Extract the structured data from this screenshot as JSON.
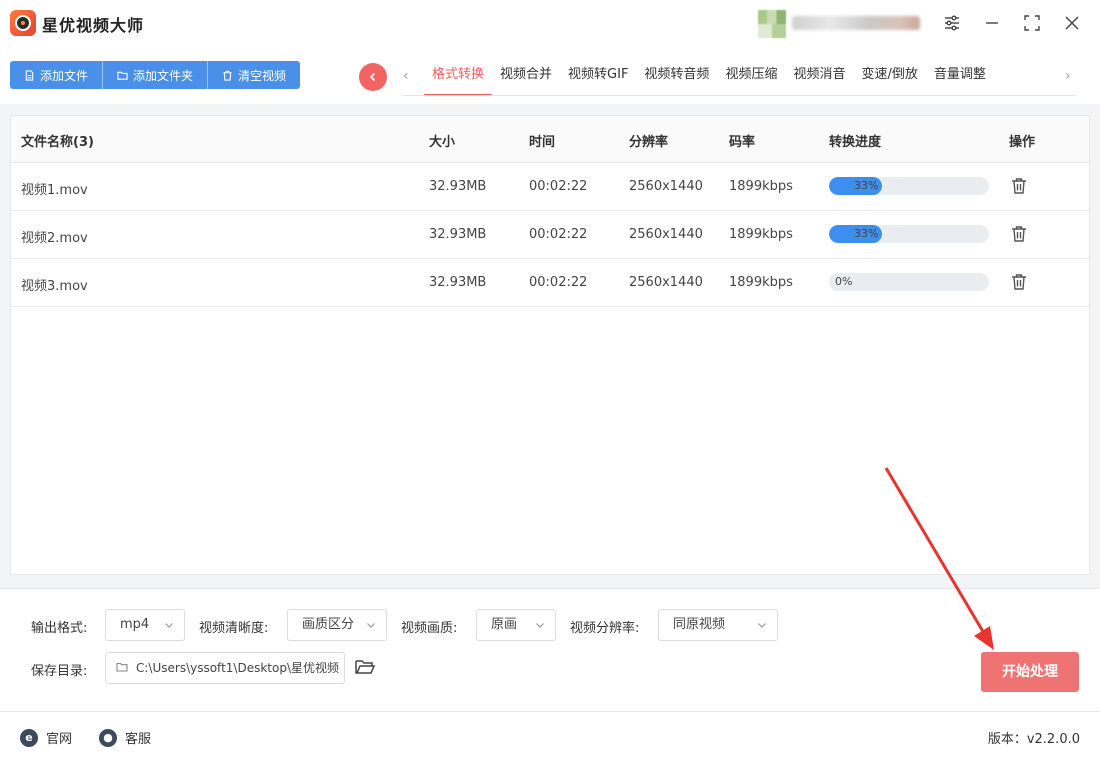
{
  "app": {
    "title": "星优视频大师"
  },
  "toolbar": {
    "buttons": [
      {
        "label": "添加文件",
        "icon": "file-icon"
      },
      {
        "label": "添加文件夹",
        "icon": "folder-icon"
      },
      {
        "label": "清空视频",
        "icon": "trash-icon"
      }
    ]
  },
  "tabs": [
    {
      "label": "格式转换",
      "active": true
    },
    {
      "label": "视频合并"
    },
    {
      "label": "视频转GIF"
    },
    {
      "label": "视频转音频"
    },
    {
      "label": "视频压缩"
    },
    {
      "label": "视频消音"
    },
    {
      "label": "变速/倒放"
    },
    {
      "label": "音量调整"
    }
  ],
  "table": {
    "headers": {
      "name": "文件名称(3)",
      "size": "大小",
      "time": "时间",
      "resolution": "分辨率",
      "bitrate": "码率",
      "progress": "转换进度",
      "action": "操作"
    },
    "rows": [
      {
        "name": "视频1.mov",
        "size": "32.93MB",
        "time": "00:02:22",
        "resolution": "2560x1440",
        "bitrate": "1899kbps",
        "progress": 0.33,
        "progress_text": "33%"
      },
      {
        "name": "视频2.mov",
        "size": "32.93MB",
        "time": "00:02:22",
        "resolution": "2560x1440",
        "bitrate": "1899kbps",
        "progress": 0.33,
        "progress_text": "33%"
      },
      {
        "name": "视频3.mov",
        "size": "32.93MB",
        "time": "00:02:22",
        "resolution": "2560x1440",
        "bitrate": "1899kbps",
        "progress": 0.0,
        "progress_text": "0%"
      }
    ]
  },
  "settings": {
    "format_label": "输出格式:",
    "format_value": "mp4",
    "clarity_label": "视频清晰度:",
    "clarity_value": "画质区分",
    "quality_label": "视频画质:",
    "quality_value": "原画",
    "resolution_label": "视频分辨率:",
    "resolution_value": "同原视频",
    "save_label": "保存目录:",
    "save_path": "C:\\Users\\yssoft1\\Desktop\\星优视频",
    "start_label": "开始处理"
  },
  "footer": {
    "website": "官网",
    "service": "客服",
    "version": "版本：v2.2.0.0"
  },
  "colors": {
    "accent_blue": "#4a90e8",
    "accent_red": "#f06060",
    "start_button": "#f07373",
    "progress_fill": "#3e8ef0"
  }
}
